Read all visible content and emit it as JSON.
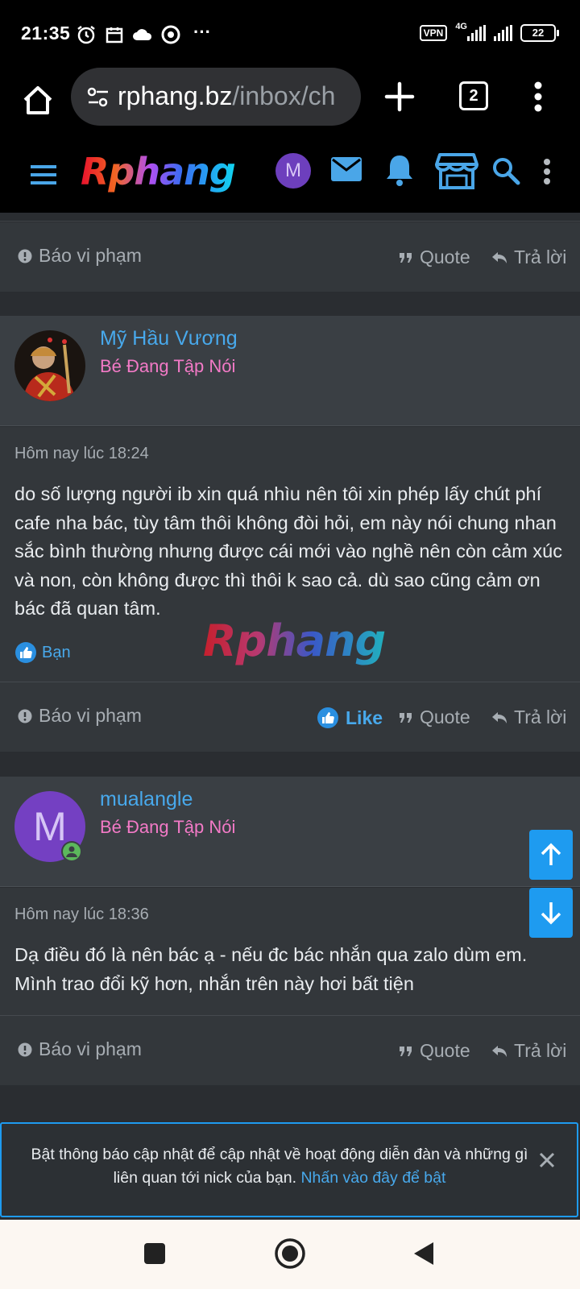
{
  "status_bar": {
    "time": "21:35",
    "vpn_label": "VPN",
    "network": "4G",
    "battery": "22",
    "icons": [
      "alarm-icon",
      "calendar-icon",
      "cloud-icon",
      "chrome-icon",
      "more-dots"
    ]
  },
  "browser": {
    "url_host": "rphang.bz",
    "url_path": "/inbox/ch",
    "tab_count": "2"
  },
  "site_header": {
    "logo": "Rphang",
    "avatar_letter": "M"
  },
  "actions": {
    "report": "Báo vi phạm",
    "quote": "Quote",
    "reply": "Trả lời",
    "like": "Like"
  },
  "posts": [
    {
      "username": "Mỹ Hầu Vương",
      "user_title": "Bé Đang Tập Nói",
      "timestamp": "Hôm nay lúc 18:24",
      "message": "do số lượng người ib xin quá nhìu nên tôi xin phép lấy chút phí cafe nha bác, tùy tâm thôi không đòi hỏi, em này nói chung nhan sắc bình thường nhưng được cái mới vào nghề nên còn cảm xúc và non, còn không được thì thôi k sao cả. dù sao cũng cảm ơn bác đã quan tâm.",
      "reaction": "Bạn"
    },
    {
      "username": "mualangle",
      "user_title": "Bé Đang Tập Nói",
      "avatar_letter": "M",
      "timestamp": "Hôm nay lúc 18:36",
      "message": "Dạ điều đó là nên bác ạ - nếu đc bác nhắn qua zalo dùm em. Mình trao đổi kỹ hơn, nhắn trên này hơi bất tiện"
    }
  ],
  "watermark": "Rphang",
  "notification": {
    "text": "Bật thông báo cập nhật để cập nhật về hoạt động diễn đàn và những gì liên quan tới nick của bạn. ",
    "link": "Nhấn vào đây để bật"
  },
  "colors": {
    "accent": "#1e9bf0",
    "link": "#48a9ec",
    "user_title": "#f37ac7",
    "card": "#33373b",
    "background": "#2a2d31"
  }
}
